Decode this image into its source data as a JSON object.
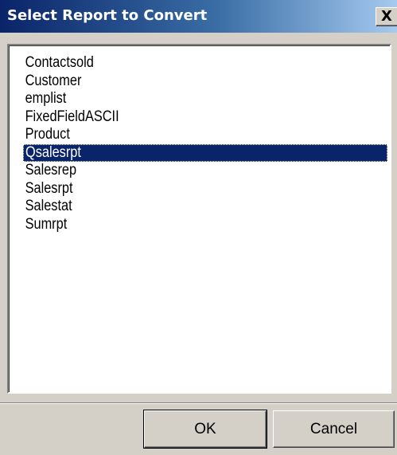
{
  "window": {
    "title": "Select Report to Convert",
    "close_glyph": "X"
  },
  "report_list": {
    "items": [
      {
        "label": "Contactsold",
        "selected": false
      },
      {
        "label": "Customer",
        "selected": false
      },
      {
        "label": "emplist",
        "selected": false
      },
      {
        "label": "FixedFieldASCII",
        "selected": false
      },
      {
        "label": "Product",
        "selected": false
      },
      {
        "label": "Qsalesrpt",
        "selected": true
      },
      {
        "label": "Salesrep",
        "selected": false
      },
      {
        "label": "Salesrpt",
        "selected": false
      },
      {
        "label": "Salestat",
        "selected": false
      },
      {
        "label": "Sumrpt",
        "selected": false
      }
    ]
  },
  "buttons": {
    "ok_label": "OK",
    "cancel_label": "Cancel"
  },
  "colors": {
    "title_bar": "#0a246a",
    "selection": "#0a246a",
    "dialog_face": "#d4d0c8"
  }
}
